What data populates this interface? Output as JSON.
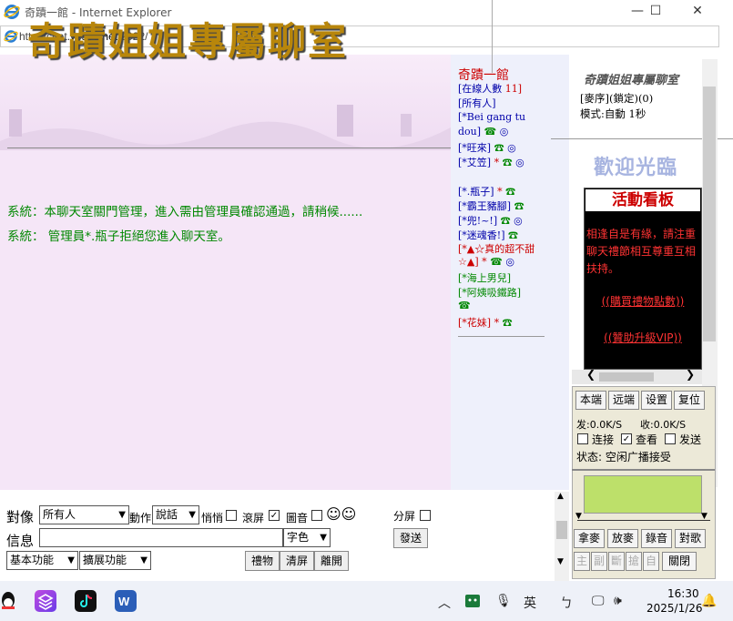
{
  "window": {
    "title": "奇蹟一館 - Internet Explorer",
    "minimize": "—",
    "maximize": "☐",
    "close": "✕"
  },
  "address": {
    "prefix": "http://chat.",
    "host": "yes98.net",
    "suffix": ":2022/"
  },
  "banner": {
    "title": "奇蹟姐姐專屬聊室"
  },
  "messages": [
    "系統：本聊天室關門管理，進入需由管理員確認通過，請稍候......",
    "系統： 管理員*.瓶子拒絕您進入聊天室。"
  ],
  "userlist": {
    "room": "奇蹟一館",
    "online_label": "[在線人數",
    "online_count": "11]",
    "all": "[所有人]",
    "users": [
      {
        "name": "[*Bei gang tu",
        "cont": "dou]",
        "star": ""
      },
      {
        "name": "[*旺來]",
        "star": ""
      },
      {
        "name": "[*艾笠]",
        "star": "*"
      },
      {
        "name": "[*.瓶子]",
        "star": "*"
      },
      {
        "name": "[*霸王豬腳]",
        "star": ""
      },
      {
        "name": "[*兜!~!]",
        "star": ""
      },
      {
        "name": "[*迷魂香!]",
        "star": ""
      },
      {
        "name": "[*▲☆真的超不甜",
        "cont": "☆▲]",
        "star": "*"
      },
      {
        "name": "[*海上男兒]",
        "star": ""
      },
      {
        "name": "[*阿姨吸鐵路]",
        "star": ""
      },
      {
        "name": "[*花妹]",
        "star": "*"
      }
    ]
  },
  "rightpanel": {
    "title": "奇蹟姐姐專屬聊室",
    "line1": "[麥序](鎖定)(0)",
    "line2": "模式:自動 1秒",
    "welcome": "歡迎光臨",
    "board_title": "活動看板",
    "board_text": "相逢自是有緣，請注重聊天禮節相互尊重互相扶持。",
    "link1": "((購買禮物點數))",
    "link2": "((贊助升級VIP))"
  },
  "media": {
    "btn_local": "本端",
    "btn_remote": "远端",
    "btn_settings": "设置",
    "btn_reset": "复位",
    "send_rate": "发:0.0K/S",
    "recv_rate": "收:0.0K/S",
    "cb_connect": "连接",
    "cb_view": "查看",
    "cb_send": "发送",
    "status": "状态: 空闲广播接受",
    "btn_grab": "拿麥",
    "btn_release": "放麥",
    "btn_record": "錄音",
    "btn_duet": "對歌",
    "small": [
      "主",
      "副",
      "斷",
      "搶",
      "自"
    ],
    "btn_close": "關閉"
  },
  "toolbar": {
    "target_label": "對像",
    "target_value": "所有人",
    "action_label": "動作",
    "action_value": "說話",
    "whisper": "悄悄",
    "scroll": "滾屏",
    "picture": "圖音",
    "emoji": "☺☺",
    "split": "分屏",
    "message_label": "信息",
    "message_value": "",
    "color_label": "字色",
    "send": "發送",
    "basic": "基本功能",
    "extend": "擴展功能",
    "gift": "禮物",
    "clear": "清屏",
    "leave": "離開"
  },
  "taskbar": {
    "ime": "英",
    "time": "16:30",
    "date": "2025/1/26"
  }
}
